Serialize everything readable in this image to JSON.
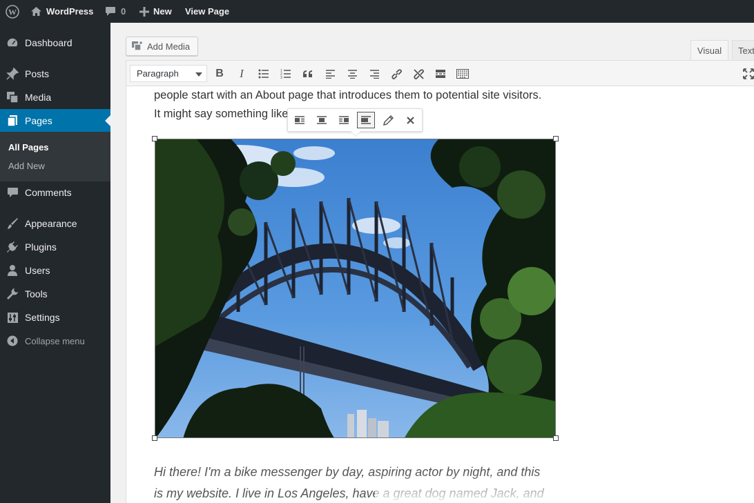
{
  "adminbar": {
    "site_name": "WordPress",
    "comments_count": "0",
    "new_label": "New",
    "view_page_label": "View Page"
  },
  "sidebar": {
    "items": [
      {
        "label": "Dashboard",
        "icon": "dashboard-icon"
      },
      {
        "label": "Posts",
        "icon": "pin-icon"
      },
      {
        "label": "Media",
        "icon": "media-icon"
      },
      {
        "label": "Pages",
        "icon": "pages-icon"
      },
      {
        "label": "Comments",
        "icon": "comment-icon"
      },
      {
        "label": "Appearance",
        "icon": "brush-icon"
      },
      {
        "label": "Plugins",
        "icon": "plugin-icon"
      },
      {
        "label": "Users",
        "icon": "user-icon"
      },
      {
        "label": "Tools",
        "icon": "wrench-icon"
      },
      {
        "label": "Settings",
        "icon": "settings-icon"
      }
    ],
    "submenu": [
      "All Pages",
      "Add New"
    ],
    "collapse_label": "Collapse menu",
    "current": "Pages"
  },
  "editor": {
    "add_media_label": "Add Media",
    "tabs": [
      "Visual",
      "Text"
    ],
    "format_select": "Paragraph",
    "toolbar_icons": [
      "bold-icon",
      "italic-icon",
      "bullet-list-icon",
      "numbered-list-icon",
      "blockquote-icon",
      "align-left-icon",
      "align-center-icon",
      "align-right-icon",
      "link-icon",
      "unlink-icon",
      "read-more-icon",
      "toolbar-toggle-icon",
      "fullscreen-icon"
    ],
    "paragraph_line1": "people start with an About page that introduces them to potential site visitors.",
    "paragraph_line2": "It might say something like",
    "italic_line1": "Hi there! I'm a bike messenger by day, aspiring actor by night, and this",
    "italic_line2": "is my website. I live in Los Angeles, have a great dog named Jack, and",
    "image_toolbar_icons": [
      "align-left-icon",
      "align-center-icon",
      "align-right-icon",
      "align-none-icon",
      "edit-icon",
      "remove-icon"
    ]
  },
  "colors": {
    "adminbar_bg": "#23282d",
    "sidebar_bg": "#23282d",
    "submenu_bg": "#32373c",
    "accent": "#0073aa",
    "sky": "#4a90d9"
  }
}
